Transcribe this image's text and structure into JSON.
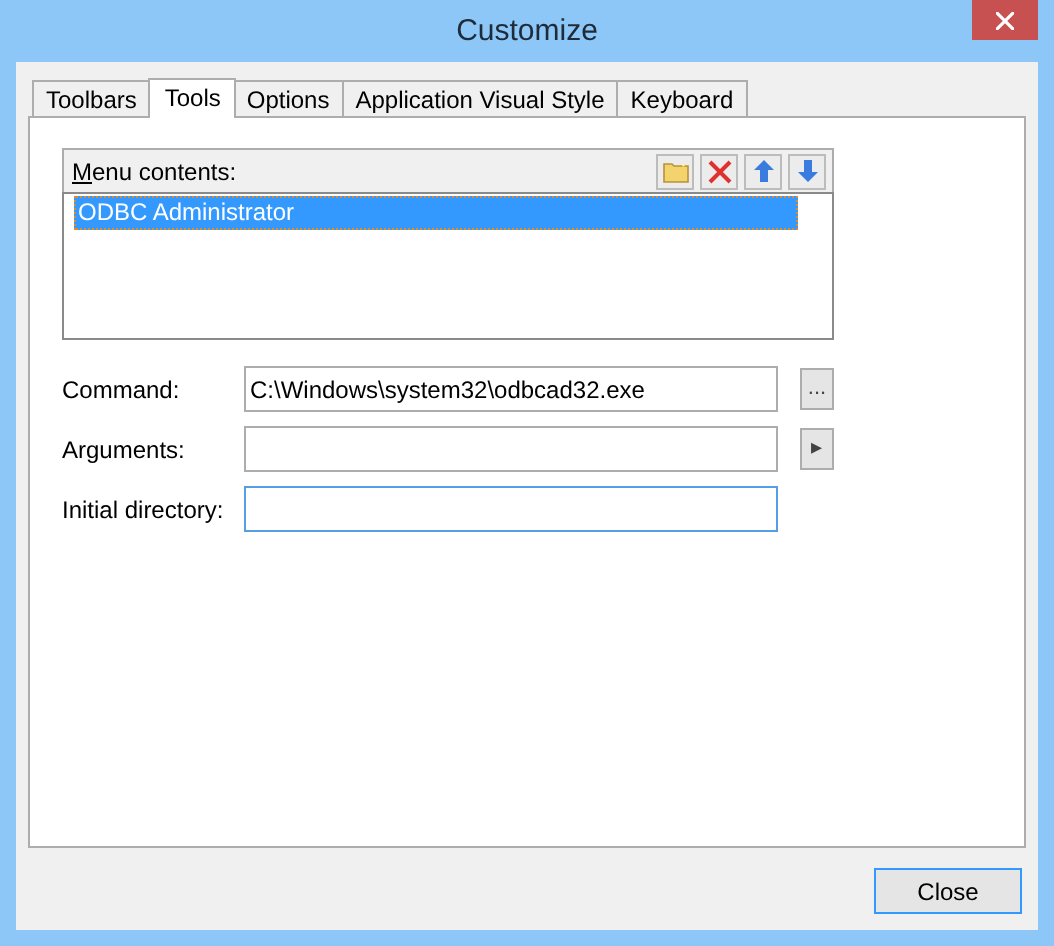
{
  "window": {
    "title": "Customize"
  },
  "tabs": [
    {
      "label": "Toolbars",
      "selected": false
    },
    {
      "label": "Tools",
      "selected": true
    },
    {
      "label": "Options",
      "selected": false
    },
    {
      "label": "Application Visual Style",
      "selected": false
    },
    {
      "label": "Keyboard",
      "selected": false
    }
  ],
  "menu_contents": {
    "label": "Menu contents:",
    "items": [
      {
        "label": "ODBC Administrator",
        "selected": true
      }
    ]
  },
  "fields": [
    {
      "label": "Command:",
      "value": "C:\\Windows\\system32\\odbcad32.exe",
      "button": "...",
      "focused": false
    },
    {
      "label": "Arguments:",
      "button": "▸",
      "focused": false
    },
    {
      "label": "Initial directory:",
      "focused": true
    }
  ],
  "buttons": [
    "Close"
  ]
}
